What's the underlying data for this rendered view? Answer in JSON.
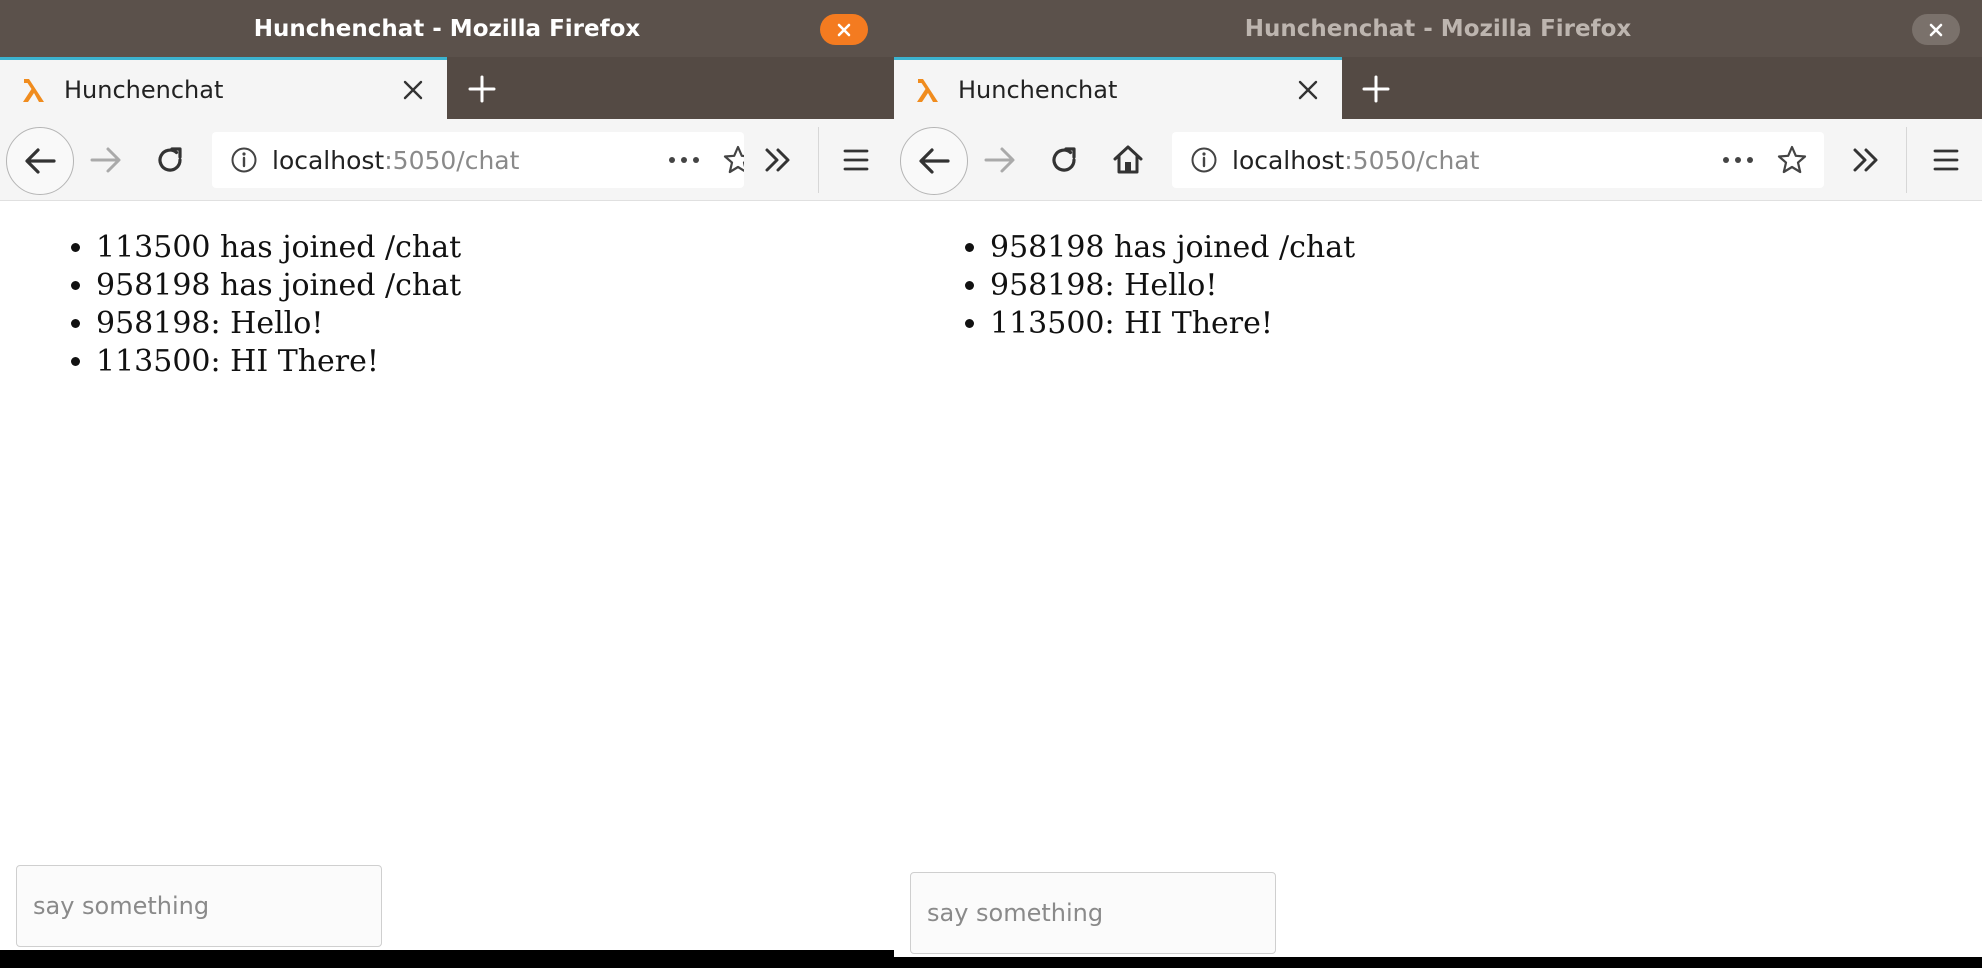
{
  "left": {
    "window_title": "Hunchenchat - Mozilla Firefox",
    "tab_label": "Hunchenchat",
    "url_host": "localhost",
    "url_rest": ":5050/chat",
    "messages": [
      "113500 has joined /chat",
      "958198 has joined /chat",
      "958198: Hello!",
      "113500: HI There!"
    ],
    "input_placeholder": "say something"
  },
  "right": {
    "window_title": "Hunchenchat - Mozilla Firefox",
    "tab_label": "Hunchenchat",
    "url_host": "localhost",
    "url_rest": ":5050/chat",
    "messages": [
      "958198 has joined /chat",
      "958198: Hello!",
      "113500: HI There!"
    ],
    "input_placeholder": "say something"
  },
  "colors": {
    "titlebar": "#5b514b",
    "active_close": "#f47b20",
    "inactive_close": "#7a716b",
    "tab_accent": "#3cb3cf",
    "lambda_icon": "#f08c1e"
  },
  "icons": [
    "lambda-icon",
    "close-icon",
    "plus-icon",
    "back-arrow-icon",
    "forward-arrow-icon",
    "reload-icon",
    "home-icon",
    "info-icon",
    "more-dots-icon",
    "star-icon",
    "overflow-chevrons-icon",
    "hamburger-menu-icon"
  ]
}
